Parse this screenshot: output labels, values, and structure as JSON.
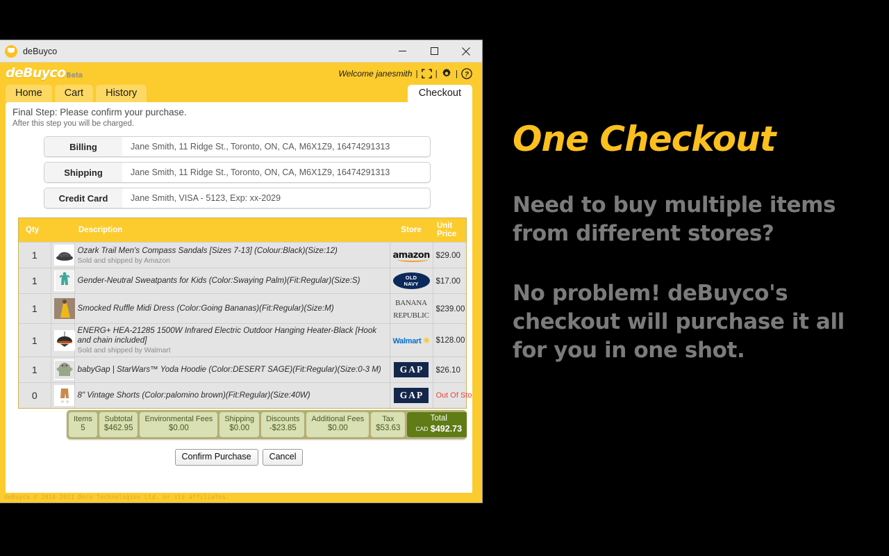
{
  "window": {
    "title": "deBuyco",
    "controls": {
      "minimize": "minimize-icon",
      "maximize": "maximize-icon",
      "close": "close-icon"
    }
  },
  "header": {
    "logo_text": "deBuyco",
    "logo_badge": "Beta",
    "welcome": "Welcome janesmith",
    "separator": "|",
    "icons": [
      "fullscreen-icon",
      "gear-icon",
      "help-icon"
    ]
  },
  "tabs": [
    {
      "label": "Home",
      "active": false
    },
    {
      "label": "Cart",
      "active": false
    },
    {
      "label": "History",
      "active": false
    },
    {
      "label": "Checkout",
      "active": true
    }
  ],
  "step": {
    "title": "Final Step: Please confirm your purchase.",
    "subtitle": "After this step you will be charged."
  },
  "address_rows": [
    {
      "label": "Billing",
      "value": "Jane Smith, 11 Ridge St., Toronto, ON, CA, M6X1Z9, 16474291313"
    },
    {
      "label": "Shipping",
      "value": "Jane Smith, 11 Ridge St., Toronto, ON, CA, M6X1Z9, 16474291313"
    },
    {
      "label": "Credit Card",
      "value": "Jane Smith, VISA - 5123, Exp: xx-2029"
    }
  ],
  "table": {
    "headers": {
      "qty": "Qty",
      "description": "Description",
      "store": "Store",
      "unit_price": "Unit\nPrice"
    },
    "header_qty": "Qty",
    "header_description": "Description",
    "header_store": "Store",
    "header_price_line1": "Unit",
    "header_price_line2": "Price",
    "rows": [
      {
        "qty": "1",
        "description": "Ozark Trail Men's Compass Sandals [Sizes 7-13] (Colour:Black)(Size:12)",
        "sub": "Sold and shipped by Amazon",
        "store": "amazon",
        "price": "$29.00",
        "thumb": "sandal-thumbnail"
      },
      {
        "qty": "1",
        "description": "Gender-Neutral Sweatpants for Kids (Color:Swaying Palm)(Fit:Regular)(Size:S)",
        "sub": "",
        "store": "OLD NAVY",
        "price": "$17.00",
        "thumb": "sweatpants-thumbnail"
      },
      {
        "qty": "1",
        "description": "Smocked Ruffle Midi Dress (Color:Going Bananas)(Fit:Regular)(Size:M)",
        "sub": "",
        "store": "BANANA REPUBLIC",
        "price": "$239.00",
        "thumb": "dress-thumbnail"
      },
      {
        "qty": "1",
        "description": "ENERG+ HEA-21285 1500W Infrared Electric Outdoor Hanging Heater-Black [Hook and chain included]",
        "sub": "Sold and shipped by Walmart",
        "store": "Walmart",
        "price": "$128.00",
        "thumb": "heater-thumbnail"
      },
      {
        "qty": "1",
        "description": "babyGap | StarWars™ Yoda Hoodie (Color:DESERT SAGE)(Fit:Regular)(Size:0-3 M)",
        "sub": "",
        "store": "GAP",
        "price": "$26.10",
        "thumb": "hoodie-thumbnail"
      },
      {
        "qty": "0",
        "description": "8\" Vintage Shorts (Color:palomino brown)(Fit:Regular)(Size:40W)",
        "sub": "",
        "store": "GAP",
        "price": "Out Of Stock",
        "thumb": "shorts-thumbnail"
      }
    ]
  },
  "totals": [
    {
      "label": "Items",
      "value": "5"
    },
    {
      "label": "Subtotal",
      "value": "$462.95"
    },
    {
      "label": "Environmental Fees",
      "value": "$0.00"
    },
    {
      "label": "Shipping",
      "value": "$0.00"
    },
    {
      "label": "Discounts",
      "value": "-$23.85"
    },
    {
      "label": "Additional Fees",
      "value": "$0.00"
    },
    {
      "label": "Tax",
      "value": "$53.63"
    }
  ],
  "total": {
    "label": "Total",
    "currency": "CAD",
    "value": "$492.73"
  },
  "buttons": {
    "confirm": "Confirm Purchase",
    "cancel": "Cancel"
  },
  "footer": "deBuyco © 2014-2021 Deco Technologies Ltd. or its affiliates.",
  "promo": {
    "title": "One Checkout",
    "paragraph1_line1": "Need to buy multiple items",
    "paragraph1_line2": "from different stores?",
    "paragraph2_line1": "No problem! deBuyco's",
    "paragraph2_line2": "checkout will purchase it all",
    "paragraph2_line3": "for you in one shot."
  },
  "colors": {
    "brand_yellow": "#fccb2e",
    "tab_inactive": "#fdd862",
    "total_green": "#5f7c16",
    "totals_cell": "#d8e0b4",
    "totals_bar": "#b5ae74",
    "out_of_stock_red": "#e8443b",
    "promo_title_yellow": "#fcc01e",
    "promo_text_gray": "#7b7b7b"
  }
}
